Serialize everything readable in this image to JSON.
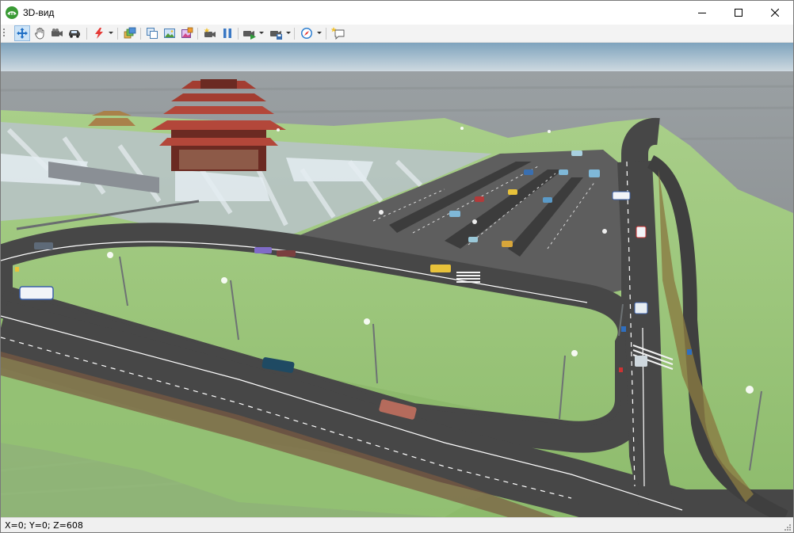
{
  "window": {
    "title": "3D-вид"
  },
  "window_controls": {
    "minimize": "minimize-icon",
    "maximize": "maximize-icon",
    "close": "close-icon"
  },
  "toolbar": {
    "items": [
      {
        "name": "move-tool",
        "icon": "move-arrows-icon",
        "active": true
      },
      {
        "name": "pan-tool",
        "icon": "hand-icon"
      },
      {
        "name": "camera-tool",
        "icon": "video-camera-icon"
      },
      {
        "name": "car-view-tool",
        "icon": "car-icon"
      },
      {
        "name": "lightning-tool",
        "icon": "lightning-icon",
        "dropdown": true
      },
      {
        "name": "layers-tool",
        "icon": "layers-icon"
      },
      {
        "name": "copy-view-tool",
        "icon": "copy-icon"
      },
      {
        "name": "image-tool",
        "icon": "image-icon"
      },
      {
        "name": "image-color-tool",
        "icon": "image-color-icon"
      },
      {
        "name": "record-tool",
        "icon": "record-camera-icon"
      },
      {
        "name": "pause-tool",
        "icon": "pause-icon"
      },
      {
        "name": "play-tool",
        "icon": "play-camera-icon",
        "dropdown": true
      },
      {
        "name": "save-video-tool",
        "icon": "save-video-icon",
        "dropdown": true
      },
      {
        "name": "navigation-tool",
        "icon": "compass-icon",
        "dropdown": true
      },
      {
        "name": "tooltip-tool",
        "icon": "tooltip-icon"
      }
    ]
  },
  "status": {
    "coords": "X=0; Y=0; Z=608"
  },
  "colors": {
    "sky_top": "#7ea3bd",
    "sky_bottom": "#d7dfe4",
    "ground": "#8f8f8f",
    "grass": "#9cc67c",
    "road": "#454545",
    "parking": "#5e5e5e",
    "accent": "#0078d7"
  }
}
